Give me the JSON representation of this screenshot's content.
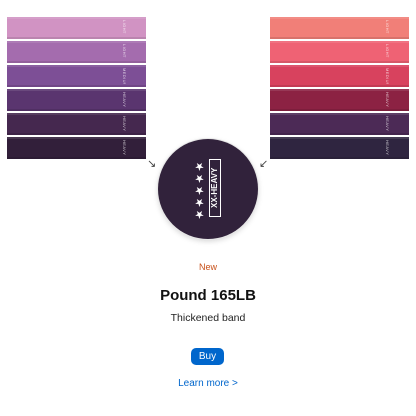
{
  "bands_left": [
    {
      "color": "#d193c3",
      "label": "LIGHT"
    },
    {
      "color": "#a46cae",
      "label": "LIGHT"
    },
    {
      "color": "#7d4f96",
      "label": "MEDIUM"
    },
    {
      "color": "#5a356f",
      "label": "HEAVY"
    },
    {
      "color": "#45284f",
      "label": "HEAVY"
    },
    {
      "color": "#321f3a",
      "label": "HEAVY"
    }
  ],
  "bands_right": [
    {
      "color": "#f17f78",
      "label": "LIGHT"
    },
    {
      "color": "#ef6274",
      "label": "LIGHT"
    },
    {
      "color": "#d8425e",
      "label": "MEDIUM"
    },
    {
      "color": "#8c2243",
      "label": "HEAVY"
    },
    {
      "color": "#4c2a56",
      "label": "HEAVY"
    },
    {
      "color": "#2f2540",
      "label": "HEAVY"
    }
  ],
  "zoom": {
    "stars": "★★★★★",
    "rating": "XX-HEAVY",
    "color": "#31223b"
  },
  "product": {
    "badge": "New",
    "title": "Pound 165LB",
    "subtitle": "Thickened band",
    "buy_label": "Buy",
    "learn_more": "Learn more >"
  },
  "colors": {
    "accent": "#0066cc",
    "badge": "#c8511a"
  }
}
